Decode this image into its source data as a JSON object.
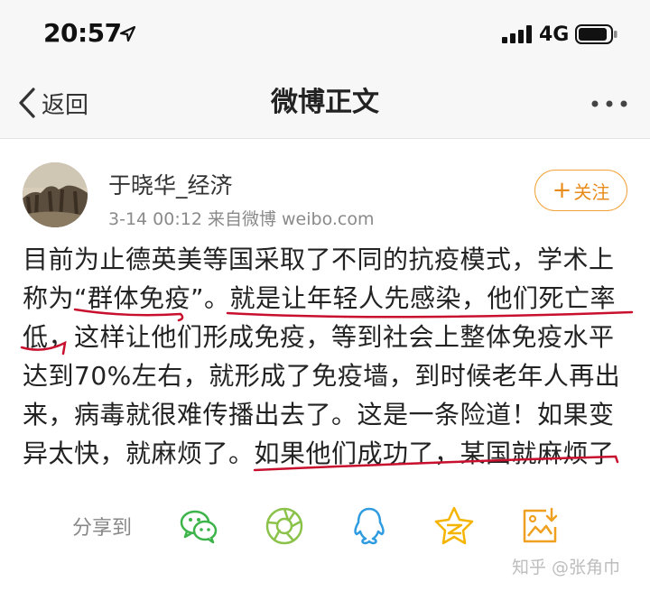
{
  "status_bar": {
    "time": "20:57",
    "network": "4G",
    "icons": [
      "location-arrow-icon",
      "signal-bars-icon",
      "battery-icon"
    ]
  },
  "nav": {
    "back_label": "返回",
    "title": "微博正文",
    "more_icon": "more-dots-icon"
  },
  "post": {
    "author": "于晓华_经济",
    "meta": "3-14 00:12  来自微博 weibo.com",
    "follow_label": "关注",
    "lines": [
      "目前为止德英美等国采取了不同的抗疫模式，学术上",
      "称为“群体免疫”。就是让年轻人先感染，他们死亡率",
      "低，这样让他们形成免疫，等到社会上整体免疫水平",
      "达到70%左右，就形成了免疫墙，到时候老年人再出",
      "来，病毒就很难传播出去了。这是一条险道！如果变",
      "异太快，就麻烦了。如果他们成功了，某国就麻烦了"
    ]
  },
  "share": {
    "label": "分享到",
    "targets": [
      "wechat-icon",
      "moments-icon",
      "qq-icon",
      "qzone-icon",
      "save-image-icon"
    ]
  },
  "watermark": "知乎 @张角巾",
  "colors": {
    "accent": "#f2a33a",
    "underline": "#c8102e",
    "wechat": "#3cb44a",
    "moments": "#8bc34a",
    "qq": "#2f9be0",
    "qzone": "#f5b400",
    "save": "#f0a020"
  }
}
